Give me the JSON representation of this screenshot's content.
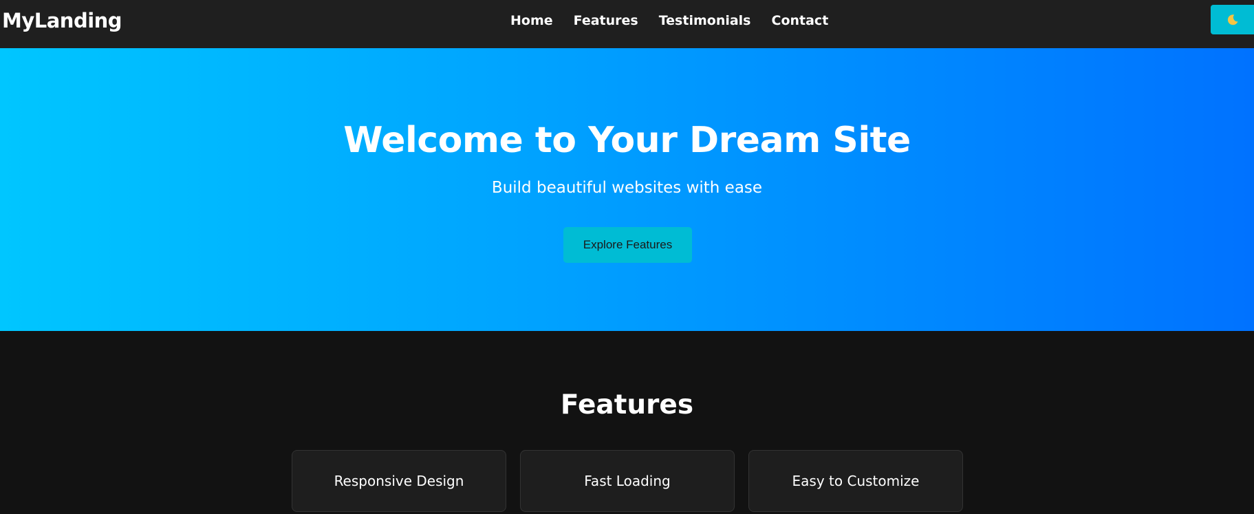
{
  "navbar": {
    "brand": "MyLanding",
    "links": [
      "Home",
      "Features",
      "Testimonials",
      "Contact"
    ],
    "theme_toggle_icon": "moon-icon"
  },
  "hero": {
    "title": "Welcome to Your Dream Site",
    "subtitle": "Build beautiful websites with ease",
    "cta_label": "Explore Features",
    "gradient_start": "#00c6ff",
    "gradient_end": "#0072ff"
  },
  "features": {
    "title": "Features",
    "cards": [
      "Responsive Design",
      "Fast Loading",
      "Easy to Customize"
    ]
  },
  "colors": {
    "accent": "#00bcd4",
    "navbar_bg": "#1f1f1f",
    "page_bg": "#121212",
    "card_bg": "#1e1e1e"
  }
}
